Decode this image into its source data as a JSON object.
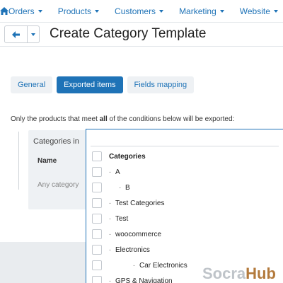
{
  "nav": {
    "items": [
      {
        "label": "Orders"
      },
      {
        "label": "Products"
      },
      {
        "label": "Customers"
      },
      {
        "label": "Marketing"
      },
      {
        "label": "Website"
      }
    ]
  },
  "page": {
    "title": "Create Category Template"
  },
  "tabs": [
    {
      "label": "General",
      "active": false
    },
    {
      "label": "Exported items",
      "active": true
    },
    {
      "label": "Fields mapping",
      "active": false
    }
  ],
  "conditions_note": {
    "before": "Only the products that meet ",
    "bold": "all",
    "after": " of the conditions below will be exported:"
  },
  "condition": {
    "title": "Categories in",
    "column_header": "Name",
    "value": "Any category"
  },
  "dropdown": {
    "items": [
      {
        "label": "Categories",
        "level": 0,
        "bold": true
      },
      {
        "label": "A",
        "level": 1,
        "bold": false
      },
      {
        "label": "B",
        "level": 2,
        "bold": false
      },
      {
        "label": "Test Categories",
        "level": 1,
        "bold": false
      },
      {
        "label": "Test",
        "level": 1,
        "bold": false
      },
      {
        "label": "woocommerce",
        "level": 1,
        "bold": false
      },
      {
        "label": "Electronics",
        "level": 1,
        "bold": false
      },
      {
        "label": "Car Electronics",
        "level": 3,
        "bold": false
      },
      {
        "label": "GPS & Navigation",
        "level": 1,
        "bold": false
      }
    ]
  },
  "watermark": {
    "part1": "Socra",
    "part2": "Hub"
  },
  "colors": {
    "accent": "#1f73b7",
    "tab_bg": "#eef1f4",
    "page_bg": "#e9ecef"
  }
}
